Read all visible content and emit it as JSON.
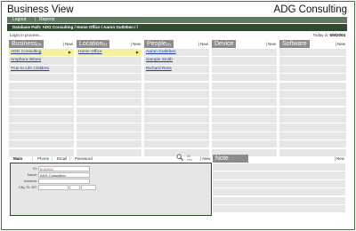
{
  "header": {
    "title": "Business View",
    "company": "ADG Consulting"
  },
  "menu": {
    "items": [
      "Logout",
      "Reports"
    ]
  },
  "database_path": "Database Path: ADG Consulting / Home Office / Aaron Gutleben / /",
  "status": {
    "login": "Login in process...",
    "today_label": "Today is:",
    "today_value": "6/9/2004"
  },
  "new_label": "New",
  "panels": [
    {
      "title": "Business",
      "count": "(3)",
      "items": [
        "ADG Consulting",
        "Amphora Wines",
        "True to Life Children"
      ],
      "selected_index": 0
    },
    {
      "title": "Location",
      "count": "(1)",
      "items": [
        "Home Office"
      ],
      "selected_index": 0
    },
    {
      "title": "People",
      "count": "(3)",
      "items": [
        "Aaron Gutleben",
        "Sample Smith",
        "Richard Ross"
      ],
      "selected_index": -1
    },
    {
      "title": "Device",
      "count": "",
      "items": [],
      "selected_index": -1
    },
    {
      "title": "Software",
      "count": "",
      "items": [],
      "selected_index": -1
    }
  ],
  "detail_tabs": [
    "Main",
    "Phone",
    "Email",
    "Password"
  ],
  "detail_active_tab": "Main",
  "search": {
    "all_label": "All\nInfo"
  },
  "detail_fields": [
    {
      "label": "ID:",
      "value": "B-00001"
    },
    {
      "label": "Name:",
      "value": "ADG Consulting"
    },
    {
      "label": "Address:",
      "value": ""
    },
    {
      "label": "City, St, ZIP:",
      "value": ""
    }
  ],
  "note": {
    "title": "Note"
  },
  "colors": {
    "panel_header": "#8c8c8c",
    "selected_row": "#f5f19e",
    "nav_bar": "#2f4a2f",
    "link": "#1c3ea8"
  }
}
